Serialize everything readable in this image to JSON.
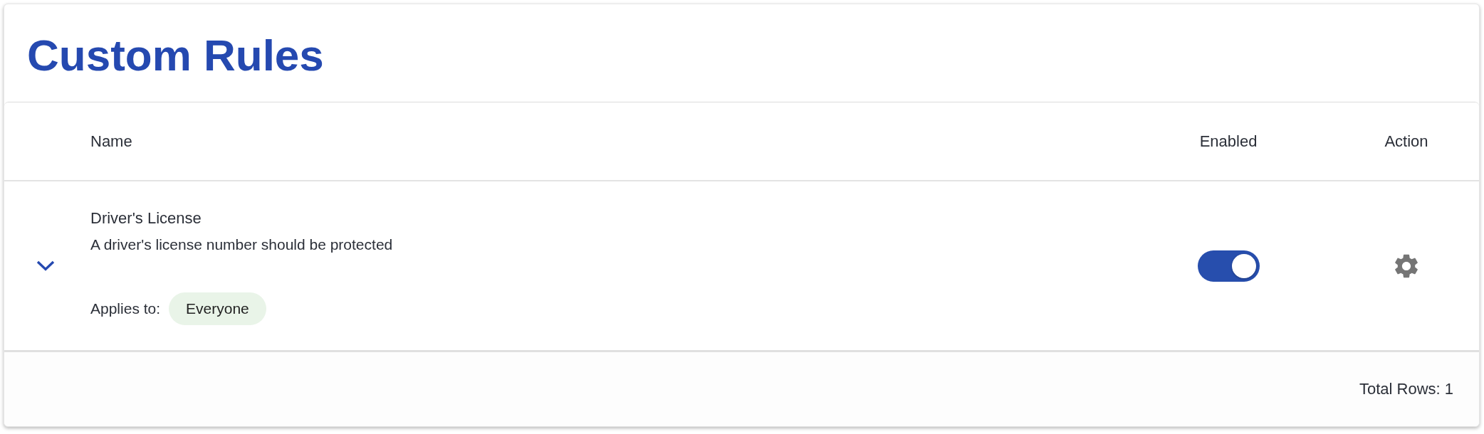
{
  "title": "Custom Rules",
  "table": {
    "columns": [
      {
        "label": "Name"
      },
      {
        "label": "Enabled"
      },
      {
        "label": "Action"
      }
    ],
    "rows": [
      {
        "expanded": false,
        "name": "Driver's License",
        "description": "A driver's license number should be protected",
        "applies_to_label": "Applies to:",
        "tags": [
          "Everyone"
        ],
        "enabled": true
      }
    ]
  },
  "footer": {
    "total_rows": "Total Rows: 1"
  }
}
